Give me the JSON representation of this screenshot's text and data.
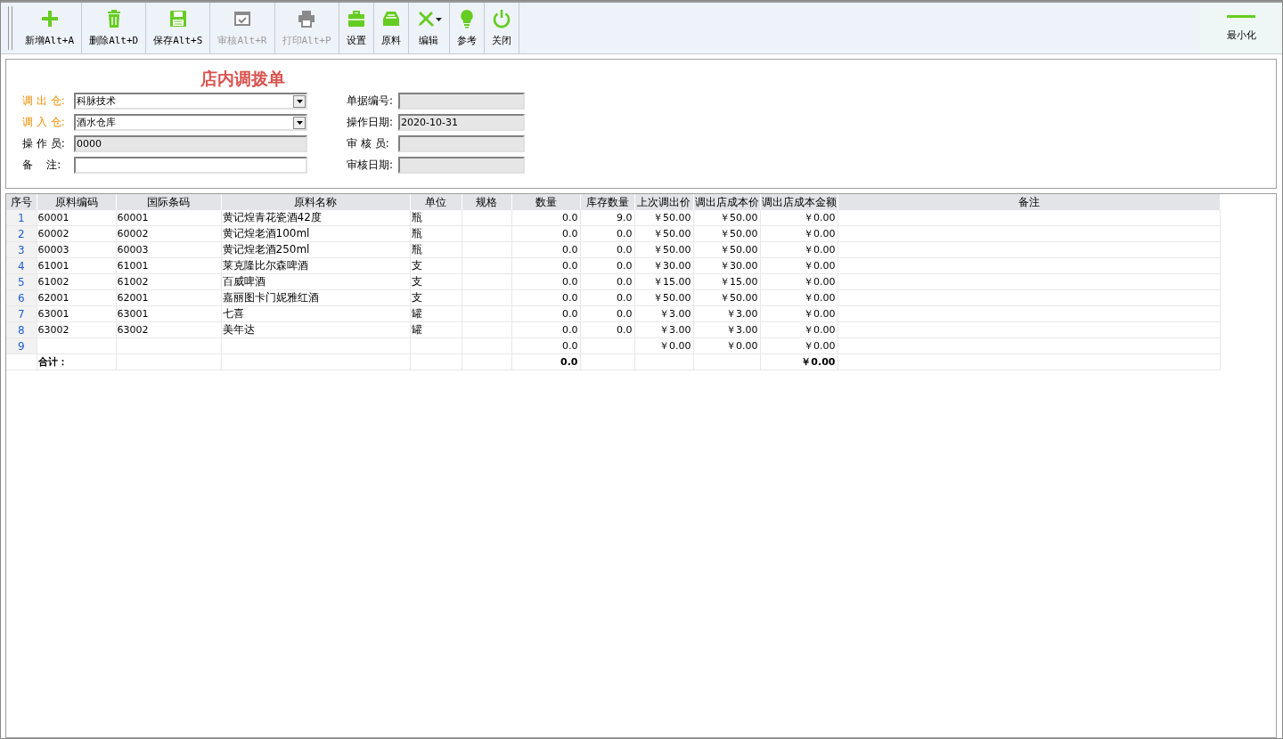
{
  "toolbar": {
    "buttons": [
      {
        "kind": "plus",
        "label": "新增Alt+A",
        "disabled": false
      },
      {
        "kind": "trash",
        "label": "删除Alt+D",
        "disabled": false
      },
      {
        "kind": "save",
        "label": "保存Alt+S",
        "disabled": false
      },
      {
        "kind": "check",
        "label": "审核Alt+R",
        "disabled": true
      },
      {
        "kind": "print",
        "label": "打印Alt+P",
        "disabled": true
      },
      {
        "kind": "briefcase",
        "label": "设置",
        "disabled": false
      },
      {
        "kind": "tray",
        "label": "原料",
        "disabled": false
      },
      {
        "kind": "tools",
        "label": "编辑",
        "disabled": false,
        "dropdown": true
      },
      {
        "kind": "bulb",
        "label": "参考",
        "disabled": false
      },
      {
        "kind": "power",
        "label": "关闭",
        "disabled": false
      }
    ],
    "minimize": {
      "label": "最小化"
    }
  },
  "form": {
    "title": "店内调拨单",
    "left_fields": [
      {
        "label": "调 出 仓:",
        "required": true,
        "kind": "select",
        "value": "科脉技术",
        "disabled": false
      },
      {
        "label": "调 入 仓:",
        "required": true,
        "kind": "select",
        "value": "酒水仓库",
        "disabled": false
      },
      {
        "label": "操 作 员:",
        "required": false,
        "kind": "text",
        "value": "0000",
        "disabled": true
      },
      {
        "label": "备    注:",
        "required": false,
        "kind": "text",
        "disabled": false
      }
    ],
    "right_fields": [
      {
        "label": "单据编号:",
        "required": false,
        "kind": "text",
        "disabled": true
      },
      {
        "label": "操作日期:",
        "required": false,
        "kind": "text",
        "value": "2020-10-31",
        "disabled": true
      },
      {
        "label": "审 核 员:",
        "required": false,
        "kind": "text",
        "disabled": true
      },
      {
        "label": "审核日期:",
        "required": false,
        "kind": "text",
        "disabled": true
      }
    ]
  },
  "table": {
    "columns": [
      "序号",
      "原料编码",
      "国际条码",
      "原料名称",
      "单位",
      "规格",
      "数量",
      "库存数量",
      "上次调出价",
      "调出店成本价",
      "调出店成本金额",
      "备注"
    ],
    "rows": [
      {
        "no": "1",
        "code": "60001",
        "barcode": "60001",
        "name": "黄记煌青花瓷酒42度",
        "unit": "瓶",
        "quantity": "0.0",
        "stock": "9.0",
        "last_price": "￥50.00",
        "cost_price": "￥50.00",
        "cost_amount": "￥0.00"
      },
      {
        "no": "2",
        "code": "60002",
        "barcode": "60002",
        "name": "黄记煌老酒100ml",
        "unit": "瓶",
        "quantity": "0.0",
        "stock": "0.0",
        "last_price": "￥50.00",
        "cost_price": "￥50.00",
        "cost_amount": "￥0.00"
      },
      {
        "no": "3",
        "code": "60003",
        "barcode": "60003",
        "name": "黄记煌老酒250ml",
        "unit": "瓶",
        "quantity": "0.0",
        "stock": "0.0",
        "last_price": "￥50.00",
        "cost_price": "￥50.00",
        "cost_amount": "￥0.00"
      },
      {
        "no": "4",
        "code": "61001",
        "barcode": "61001",
        "name": "莱克隆比尔森啤酒",
        "unit": "支",
        "quantity": "0.0",
        "stock": "0.0",
        "last_price": "￥30.00",
        "cost_price": "￥30.00",
        "cost_amount": "￥0.00"
      },
      {
        "no": "5",
        "code": "61002",
        "barcode": "61002",
        "name": "百威啤酒",
        "unit": "支",
        "quantity": "0.0",
        "stock": "0.0",
        "last_price": "￥15.00",
        "cost_price": "￥15.00",
        "cost_amount": "￥0.00"
      },
      {
        "no": "6",
        "code": "62001",
        "barcode": "62001",
        "name": "嘉丽图卡门妮雅红酒",
        "unit": "支",
        "quantity": "0.0",
        "stock": "0.0",
        "last_price": "￥50.00",
        "cost_price": "￥50.00",
        "cost_amount": "￥0.00"
      },
      {
        "no": "7",
        "code": "63001",
        "barcode": "63001",
        "name": "七喜",
        "unit": "罐",
        "quantity": "0.0",
        "stock": "0.0",
        "last_price": "￥3.00",
        "cost_price": "￥3.00",
        "cost_amount": "￥0.00"
      },
      {
        "no": "8",
        "code": "63002",
        "barcode": "63002",
        "name": "美年达",
        "unit": "罐",
        "quantity": "0.0",
        "stock": "0.0",
        "last_price": "￥3.00",
        "cost_price": "￥3.00",
        "cost_amount": "￥0.00"
      },
      {
        "no": "9",
        "quantity": "0.0",
        "last_price": "￥0.00",
        "cost_price": "￥0.00",
        "cost_amount": "￥0.00"
      }
    ],
    "total": {
      "label": "合计：",
      "quantity": "0.0",
      "cost_amount": "￥0.00"
    }
  }
}
